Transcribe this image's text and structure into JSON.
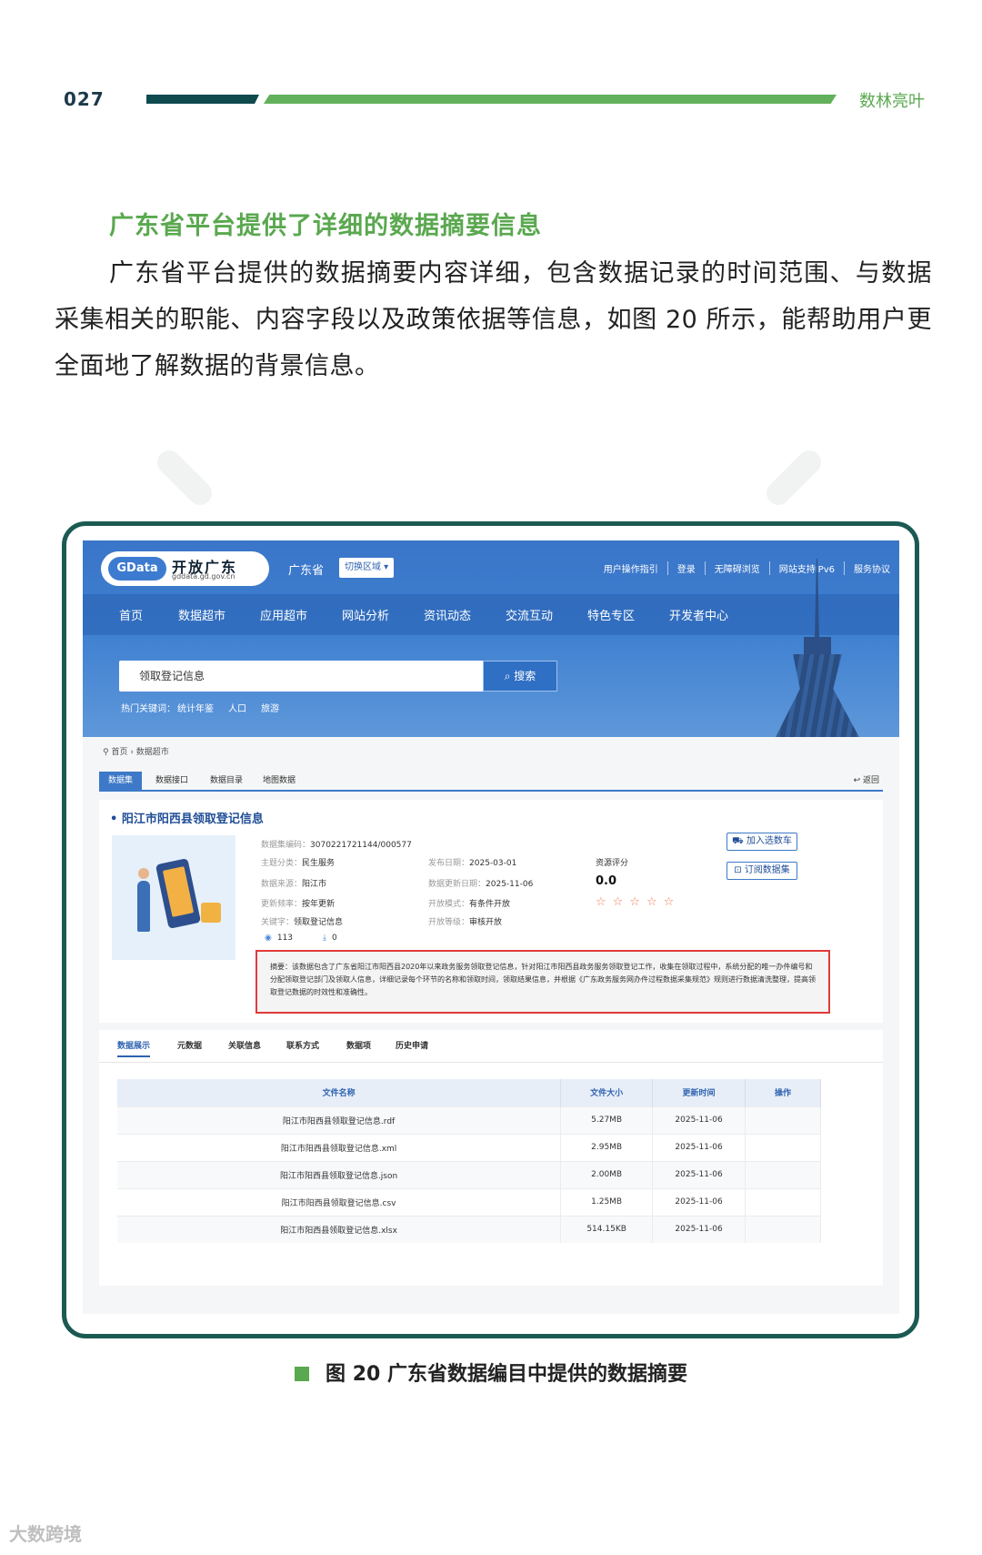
{
  "page": {
    "number": "027",
    "section": "数林亮叶"
  },
  "article": {
    "heading": "广东省平台提供了详细的数据摘要信息",
    "paragraph": "广东省平台提供的数据摘要内容详细，包含数据记录的时间范围、与数据采集相关的职能、内容字段以及政策依据等信息，如图 20 所示，能帮助用户更全面地了解数据的背景信息。"
  },
  "site": {
    "logo": {
      "badge": "GData",
      "title": "开放广东",
      "domain": "gddata.gd.gov.cn"
    },
    "region": "广东省",
    "region_switch": "切换区域 ▾",
    "top_links": [
      "用户操作指引",
      "登录",
      "无障碍浏览",
      "网站支持IPv6",
      "服务协议"
    ],
    "nav": [
      "首页",
      "数据超市",
      "应用超市",
      "网站分析",
      "资讯动态",
      "交流互动",
      "特色专区",
      "开发者中心"
    ],
    "search": {
      "value": "领取登记信息",
      "button": "搜索"
    },
    "hot": {
      "label": "热门关键词：",
      "keywords": [
        "统计年鉴",
        "人口",
        "旅游"
      ]
    },
    "breadcrumb": "首页 › 数据超市",
    "tabs": [
      "数据集",
      "数据接口",
      "数据目录",
      "地图数据"
    ],
    "back": "返回"
  },
  "dataset": {
    "title": "阳江市阳西县领取登记信息",
    "fields": {
      "code_label": "数据集编码：",
      "code": "3070221721144/000577",
      "topic_label": "主题分类：",
      "topic": "民生服务",
      "source_label": "数据来源：",
      "source": "阳江市",
      "freq_label": "更新频率：",
      "freq": "按年更新",
      "keyword_label": "关键字：",
      "keyword": "领取登记信息",
      "pub_label": "发布日期：",
      "pub": "2025-03-01",
      "upd_label": "数据更新日期：",
      "upd": "2025-11-06",
      "mode_label": "开放模式：",
      "mode": "有条件开放",
      "level_label": "开放等级：",
      "level": "审核开放"
    },
    "score_label": "资源评分",
    "score": "0.0",
    "stars": "☆☆☆☆☆",
    "actions": {
      "cart": "加入选数车",
      "subscribe": "订阅数据集"
    },
    "stats": {
      "views": "113",
      "downloads": "0"
    },
    "summary": "摘要：该数据包含了广东省阳江市阳西县2020年以来政务服务领取登记信息，针对阳江市阳西县政务服务领取登记工作，收集在领取过程中，系统分配的唯一办件编号和分配领取登记部门及领取人信息，详细记录每个环节的名称和领取时间，领取结果信息，并根据《广东政务服务网办件过程数据采集规范》规则进行数据清洗整理，提高领取登记数据的时效性和准确性。"
  },
  "detail_tabs": [
    "数据展示",
    "元数据",
    "关联信息",
    "联系方式",
    "数据项",
    "历史申请"
  ],
  "files": {
    "headers": [
      "文件名称",
      "文件大小",
      "更新时间",
      "操作"
    ],
    "rows": [
      [
        "阳江市阳西县领取登记信息.rdf",
        "5.27MB",
        "2025-11-06",
        ""
      ],
      [
        "阳江市阳西县领取登记信息.xml",
        "2.95MB",
        "2025-11-06",
        ""
      ],
      [
        "阳江市阳西县领取登记信息.json",
        "2.00MB",
        "2025-11-06",
        ""
      ],
      [
        "阳江市阳西县领取登记信息.csv",
        "1.25MB",
        "2025-11-06",
        ""
      ],
      [
        "阳江市阳西县领取登记信息.xlsx",
        "514.15KB",
        "2025-11-06",
        ""
      ]
    ]
  },
  "caption": "图 20  广东省数据编目中提供的数据摘要",
  "watermark": "大数跨境",
  "colors": {
    "accent_green": "#5aa84f",
    "frame": "#1b5a52",
    "site_blue": "#3a75c8",
    "highlight_red": "#e03a3a"
  }
}
